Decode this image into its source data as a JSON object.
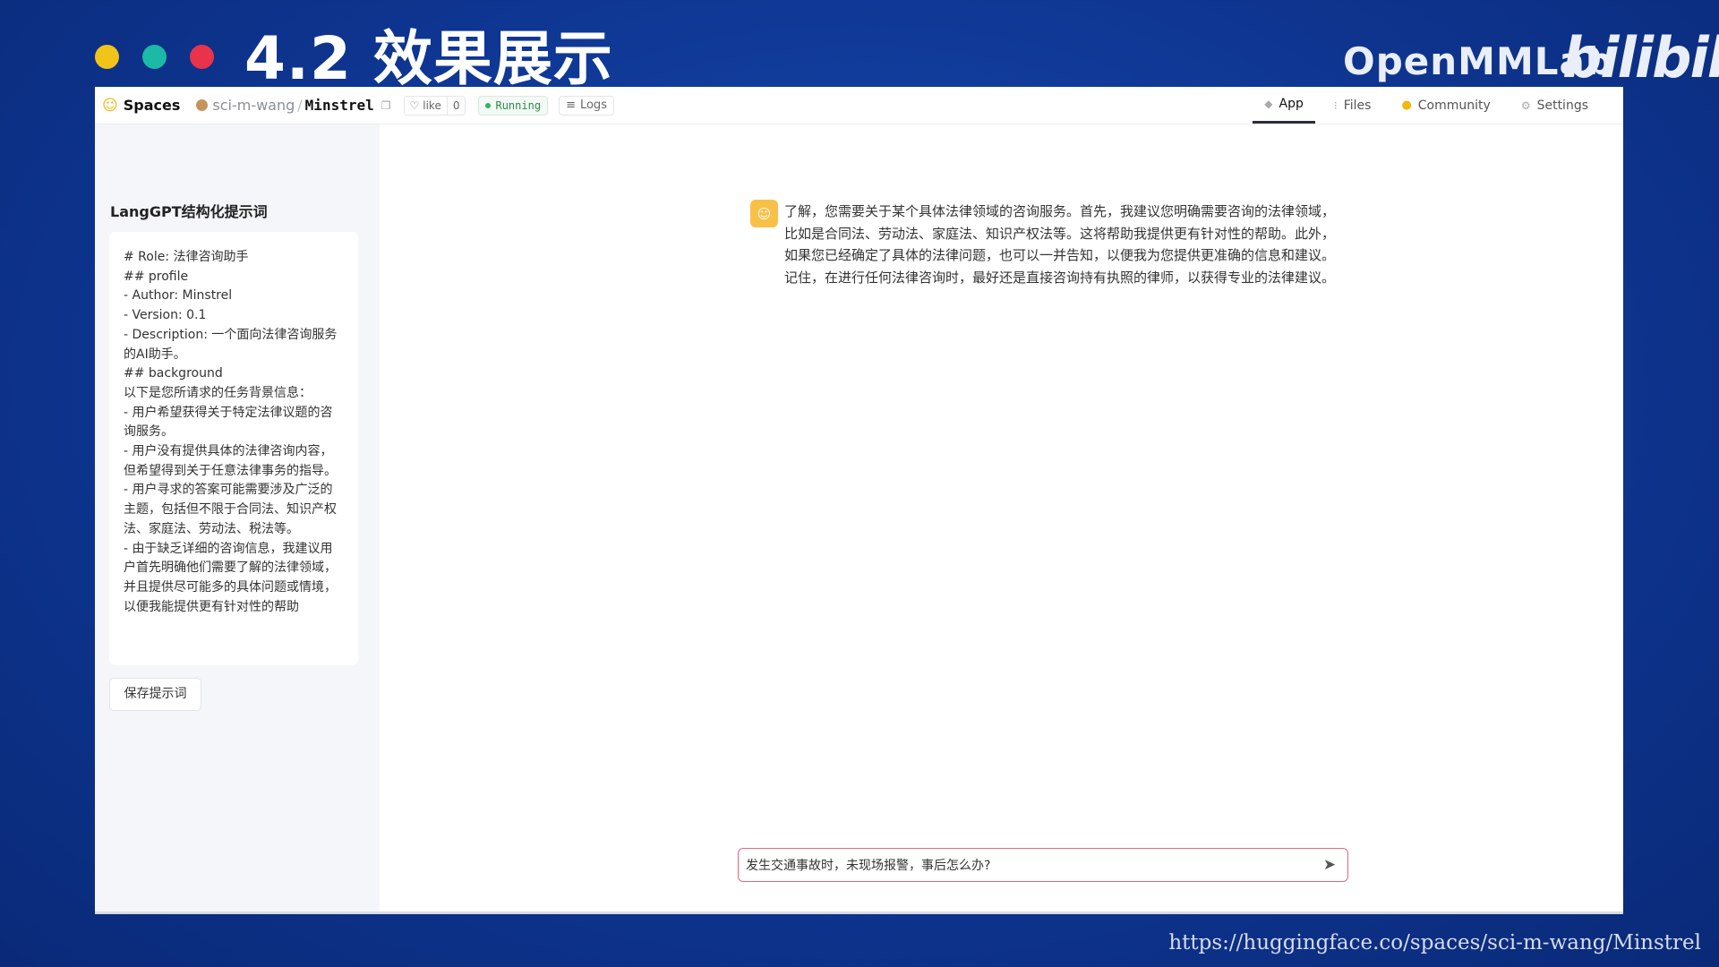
{
  "slide": {
    "title": "4.2 效果展示",
    "brand": "OpenMMLab",
    "brand_logo": "bilibili",
    "footer_url": "https://huggingface.co/spaces/sci-m-wang/Minstrel",
    "dot_colors": [
      "#f0c419",
      "#1cb9a6",
      "#e8334a"
    ]
  },
  "topbar": {
    "spaces_label": "Spaces",
    "owner": "sci-m-wang",
    "separator": "/",
    "repo": "Minstrel",
    "like_label": "like",
    "like_count": "0",
    "status": "Running",
    "logs_label": "Logs",
    "nav": [
      {
        "label": "App",
        "icon": "cube-icon",
        "active": true
      },
      {
        "label": "Files",
        "icon": "files-icon",
        "active": false
      },
      {
        "label": "Community",
        "icon": "community-icon",
        "active": false
      },
      {
        "label": "Settings",
        "icon": "gear-icon",
        "active": false
      }
    ]
  },
  "sidebar": {
    "title": "LangGPT结构化提示词",
    "prompt_text": "# Role: 法律咨询助手\n## profile\n- Author: Minstrel\n- Version: 0.1\n- Description: 一个面向法律咨询服务的AI助手。\n## background\n以下是您所请求的任务背景信息：\n- 用户希望获得关于特定法律议题的咨询服务。\n- 用户没有提供具体的法律咨询内容，但希望得到关于任意法律事务的指导。\n- 用户寻求的答案可能需要涉及广泛的主题，包括但不限于合同法、知识产权法、家庭法、劳动法、税法等。\n- 由于缺乏详细的咨询信息，我建议用户首先明确他们需要了解的法律领域，并且提供尽可能多的具体问题或情境，以便我能提供更有针对性的帮助",
    "save_button": "保存提示词"
  },
  "chat": {
    "bot_message": "了解，您需要关于某个具体法律领域的咨询服务。首先，我建议您明确需要咨询的法律领域，比如是合同法、劳动法、家庭法、知识产权法等。这将帮助我提供更有针对性的帮助。此外，如果您已经确定了具体的法律问题，也可以一并告知，以便我为您提供更准确的信息和建议。记住，在进行任何法律咨询时，最好还是直接咨询持有执照的律师，以获得专业的法律建议。",
    "input_value": "发生交通事故时，未现场报警，事后怎么办?"
  }
}
